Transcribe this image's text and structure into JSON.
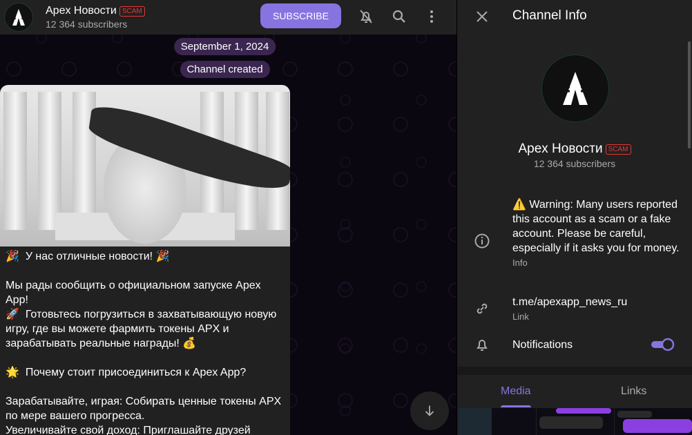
{
  "header": {
    "title": "Apex Новости",
    "badge": "SCAM",
    "subscribers": "12 364 subscribers",
    "subscribe_label": "SUBSCRIBE"
  },
  "chat": {
    "date": "September 1, 2024",
    "service": "Channel created",
    "message": "🎉  У нас отличные новости! 🎉\n\nМы рады сообщить о официальном запуске Apex App!\n🚀  Готовьтесь погрузиться в захватывающую новую игру, где вы можете фармить токены APX и зарабатывать реальные награды! 💰\n\n🌟  Почему стоит присоединиться к Apex App?\n\nЗарабатывайте, играя: Собирать ценные токены APX по мере вашего прогресса.\nУвеличивайте свой доход: Приглашайте друзей присоединиться к веселью и наблюдайте, как растут"
  },
  "panel": {
    "title": "Channel Info",
    "name": "Apex Новости",
    "badge": "SCAM",
    "subscribers": "12 364 subscribers",
    "warning": "⚠️  Warning: Many users reported this account as a scam or a fake account. Please be careful, especially if it asks you for money.",
    "warning_label": "Info",
    "link": "t.me/apexapp_news_ru",
    "link_label": "Link",
    "notifications": "Notifications",
    "notifications_on": true,
    "tabs": [
      "Media",
      "Links"
    ],
    "active_tab": "Media"
  },
  "colors": {
    "accent": "#8774e1",
    "scam": "#e53935"
  }
}
